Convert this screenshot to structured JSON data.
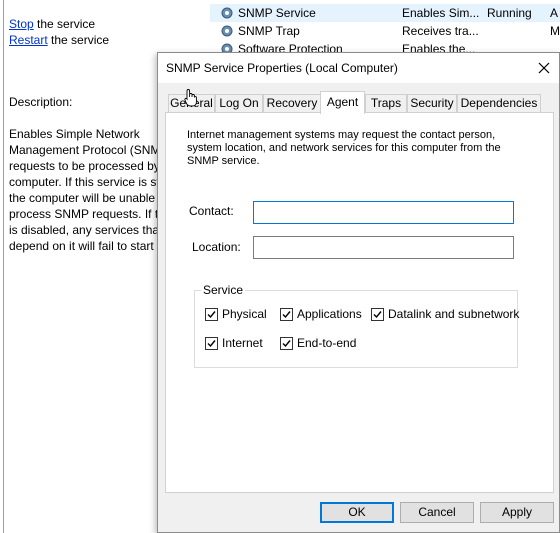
{
  "left_pane": {
    "stop_link": "Stop",
    "stop_suffix": " the service",
    "restart_link": "Restart",
    "restart_suffix": " the service",
    "description_label": "Description:",
    "description_text": "Enables Simple Network\nManagement Protocol (SNM\nrequests to be processed by\ncomputer. If this service is st\nthe computer will be unable\nprocess SNMP requests. If th\nis disabled, any services that\ndepend on it will fail to start"
  },
  "services": [
    {
      "name": "SNMP Service",
      "description": "Enables Sim...",
      "status": "Running",
      "startup": "A"
    },
    {
      "name": "SNMP Trap",
      "description": "Receives tra...",
      "status": "",
      "startup": "M"
    },
    {
      "name": "Software Protection",
      "description": "Enables the...",
      "status": "",
      "startup": ""
    }
  ],
  "dialog": {
    "title": "SNMP Service Properties (Local Computer)",
    "tabs": [
      "General",
      "Log On",
      "Recovery",
      "Agent",
      "Traps",
      "Security",
      "Dependencies"
    ],
    "active_tab": "Agent",
    "intro": "Internet management systems may request the contact person, system location, and network services for this computer from the SNMP service.",
    "contact_label": "Contact:",
    "contact_value": "",
    "location_label": "Location:",
    "location_value": "",
    "service_group_label": "Service",
    "checkboxes": [
      {
        "label": "Physical",
        "checked": true
      },
      {
        "label": "Applications",
        "checked": true
      },
      {
        "label": "Datalink and subnetwork",
        "checked": true
      },
      {
        "label": "Internet",
        "checked": true
      },
      {
        "label": "End-to-end",
        "checked": true
      }
    ],
    "buttons": {
      "ok": "OK",
      "cancel": "Cancel",
      "apply": "Apply"
    }
  },
  "colors": {
    "accent": "#0078d7",
    "link": "#0033cc",
    "selection": "#e5f3ff"
  },
  "icons": {
    "service": "gear-icon",
    "close": "close-icon",
    "checkbox": "checkmark-icon"
  }
}
